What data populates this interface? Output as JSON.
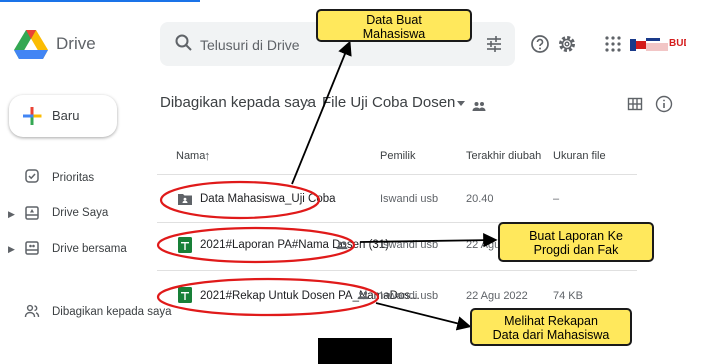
{
  "app": {
    "brand": "Drive",
    "search_placeholder": "Telusuri di Drive",
    "avatar_text": "BUD"
  },
  "sidebar": {
    "new_button": "Baru",
    "items": [
      {
        "label": "Prioritas",
        "icon": "check-icon"
      },
      {
        "label": "Drive Saya",
        "icon": "my-drive-icon"
      },
      {
        "label": "Drive bersama",
        "icon": "shared-drive-icon"
      },
      {
        "label": "Dibagikan kepada saya",
        "icon": "people-icon"
      }
    ]
  },
  "breadcrumb": {
    "parent": "Dibagikan kepada saya",
    "separator": "›",
    "current": "File Uji Coba Dosen"
  },
  "table": {
    "columns": {
      "name": "Nama",
      "owner": "Pemilik",
      "modified": "Terakhir diubah",
      "size": "Ukuran file"
    },
    "rows": [
      {
        "name": "Data Mahasiswa_Uji Coba",
        "type": "folder",
        "owner": "Iswandi usb",
        "modified": "20.40",
        "size": "–"
      },
      {
        "name": "2021#Laporan PA#Nama Dosen (31)",
        "type": "sheet",
        "owner": "Iswandi usb",
        "modified": "22 Agu 2",
        "size": ""
      },
      {
        "name": "2021#Rekap Untuk Dosen PA_NamaDos...",
        "type": "sheet",
        "owner": "Iswandi usb",
        "modified": "22 Agu 2022",
        "size": "74 KB"
      }
    ]
  },
  "annotations": [
    {
      "line1": "Data Buat",
      "line2": "Mahasiswa"
    },
    {
      "line1": "Buat Laporan Ke",
      "line2": "Progdi  dan Fak"
    },
    {
      "line1": "Melihat Rekapan",
      "line2": "Data dari Mahasiswa"
    }
  ],
  "colors": {
    "callout_fill": "#ffe85c",
    "annotation_ellipse": "#e01a1a",
    "sheet_green": "#188038",
    "drive_blue": "#1a73e8"
  }
}
